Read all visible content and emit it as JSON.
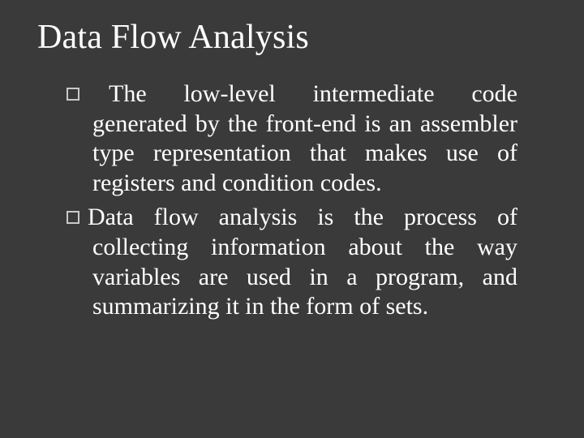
{
  "title": "Data Flow Analysis",
  "bullets": [
    "The low-level intermediate code generated by the front-end is an assembler type representation that makes use of registers and condition codes.",
    "Data flow analysis is the process of collecting information about the way variables are used in a program, and summarizing it in the form of sets."
  ]
}
